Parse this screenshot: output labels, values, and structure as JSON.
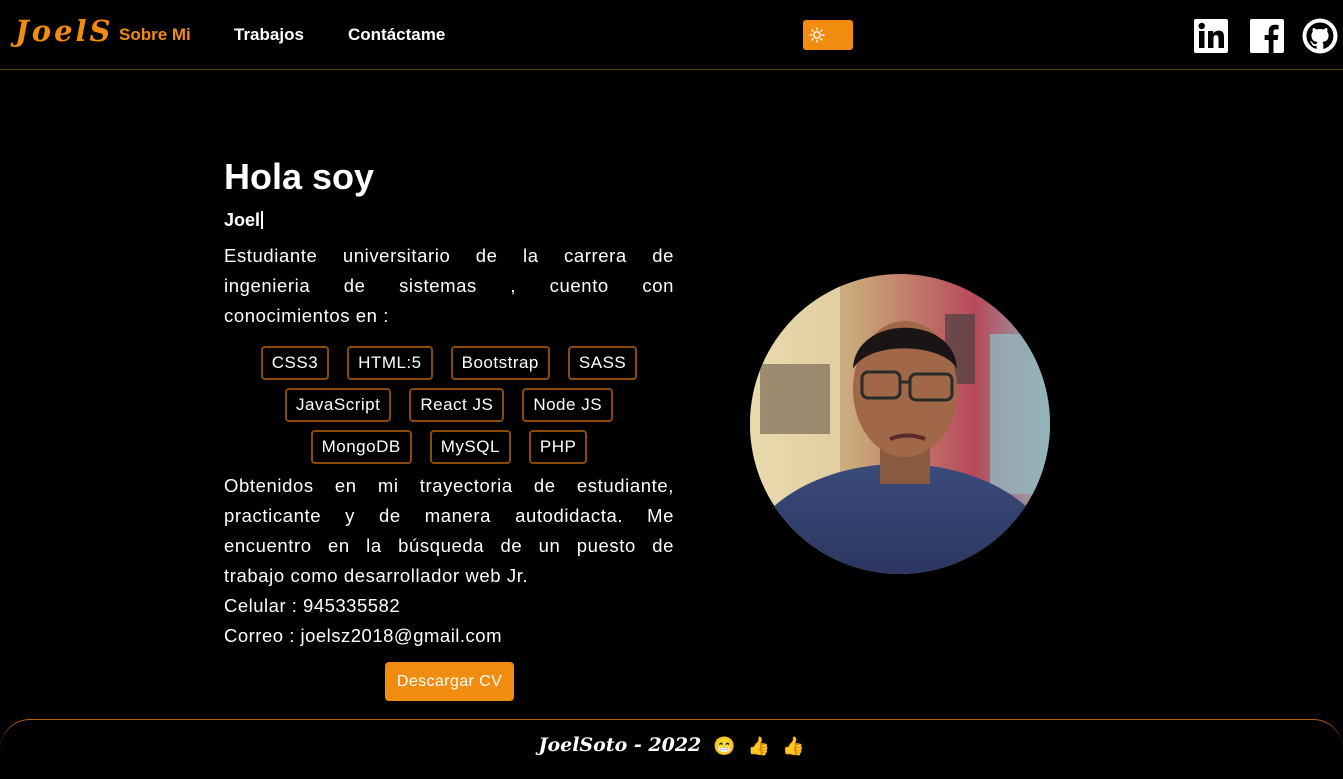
{
  "brand": {
    "logo": "JoelS",
    "accent": "#f28c0f"
  },
  "nav": {
    "items": [
      {
        "label": "Sobre Mi",
        "active": true
      },
      {
        "label": "Trabajos",
        "active": false
      },
      {
        "label": "Contáctame",
        "active": false
      }
    ],
    "theme_toggle_icon": "sun-icon",
    "social_icons": [
      "linkedin-icon",
      "facebook-icon",
      "github-icon"
    ]
  },
  "hero": {
    "title": "Hola soy",
    "name": "Joel",
    "intro_lines": [
      "Estudiante universitario de la carrera de",
      "ingenieria de sistemas , cuento con",
      "conocimientos en :"
    ],
    "skills": [
      [
        "CSS3",
        "HTML:5",
        "Bootstrap",
        "SASS"
      ],
      [
        "JavaScript",
        "React JS",
        "Node JS"
      ],
      [
        "MongoDB",
        "MySQL",
        "PHP"
      ]
    ],
    "outro_lines": [
      "Obtenidos en mi trayectoria de estudiante,",
      "practicante y de manera autodidacta. Me",
      "encuentro en la búsqueda de un puesto de",
      "trabajo como desarrollador web Jr."
    ],
    "phone": "Celular : 945335582",
    "email": "Correo : joelsz2018@gmail.com",
    "cv_button": "Descargar CV"
  },
  "footer": {
    "text": "JoelSoto - 2022",
    "emojis": [
      "😁",
      "👍",
      "👍"
    ]
  }
}
